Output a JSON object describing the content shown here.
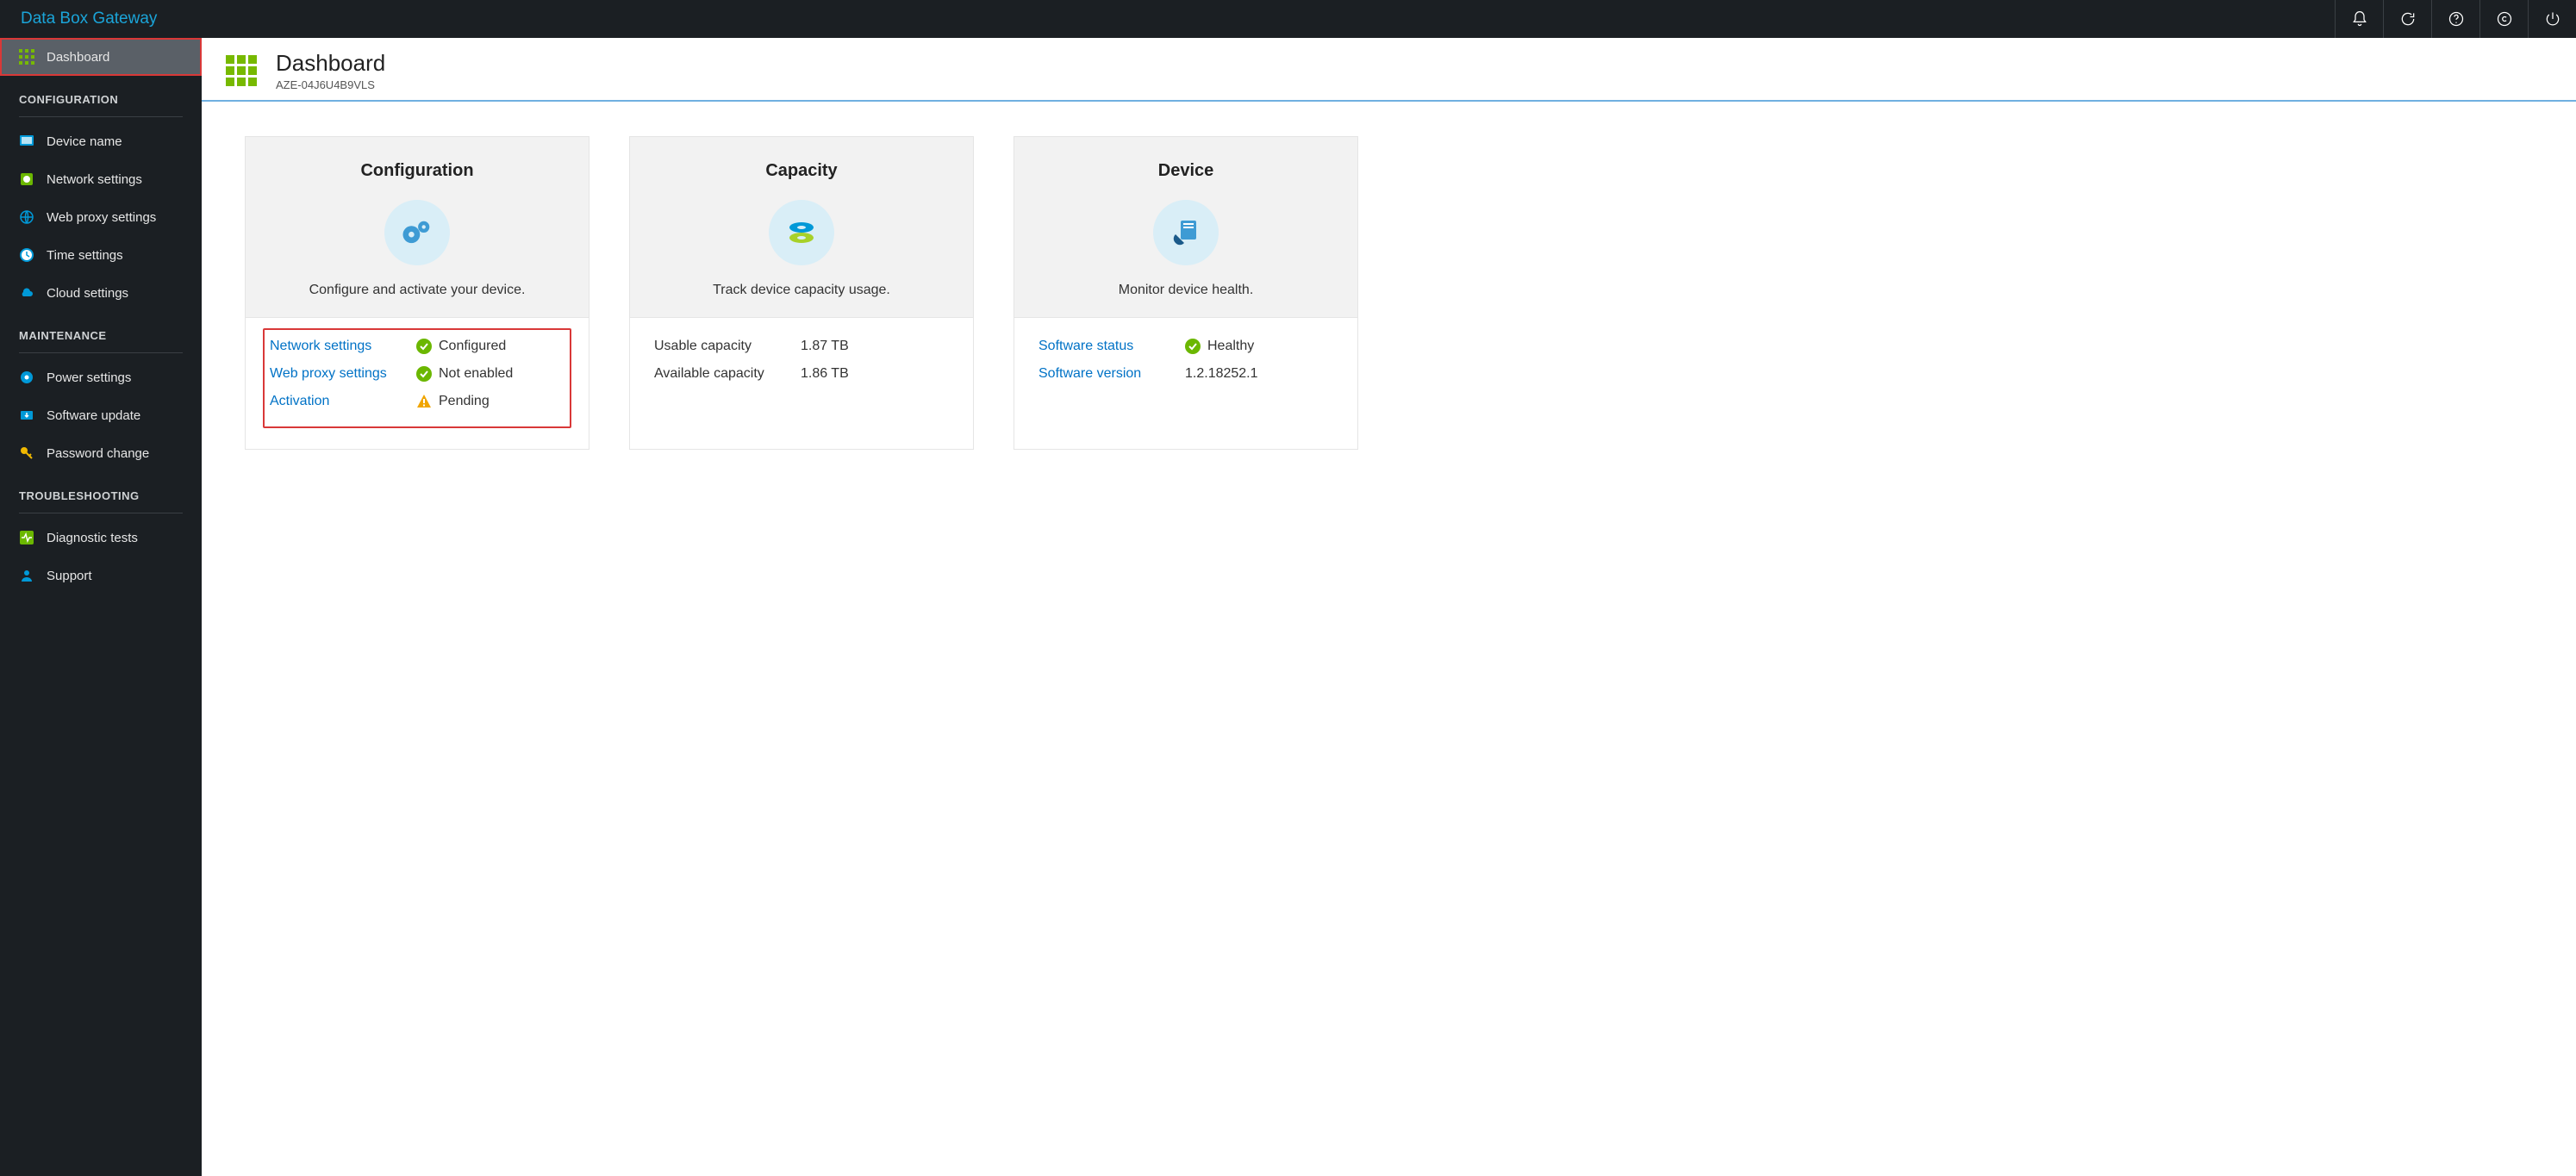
{
  "brand": "Data Box Gateway",
  "sidebar": {
    "dashboard": "Dashboard",
    "section_config": "CONFIGURATION",
    "device_name": "Device name",
    "network_settings": "Network settings",
    "web_proxy": "Web proxy settings",
    "time_settings": "Time settings",
    "cloud_settings": "Cloud settings",
    "section_maint": "MAINTENANCE",
    "power_settings": "Power settings",
    "software_update": "Software update",
    "password_change": "Password change",
    "section_trouble": "TROUBLESHOOTING",
    "diagnostic_tests": "Diagnostic tests",
    "support": "Support"
  },
  "header": {
    "title": "Dashboard",
    "subtitle": "AZE-04J6U4B9VLS"
  },
  "cards": {
    "config": {
      "title": "Configuration",
      "desc": "Configure and activate your device.",
      "rows": [
        {
          "label": "Network settings",
          "status": "ok",
          "value": "Configured"
        },
        {
          "label": "Web proxy settings",
          "status": "ok",
          "value": "Not enabled"
        },
        {
          "label": "Activation",
          "status": "warn",
          "value": "Pending"
        }
      ]
    },
    "capacity": {
      "title": "Capacity",
      "desc": "Track device capacity usage.",
      "rows": [
        {
          "label": "Usable capacity",
          "value": "1.87 TB"
        },
        {
          "label": "Available capacity",
          "value": "1.86 TB"
        }
      ]
    },
    "device": {
      "title": "Device",
      "desc": "Monitor device health.",
      "rows": [
        {
          "label": "Software status",
          "link": true,
          "status": "ok",
          "value": "Healthy"
        },
        {
          "label": "Software version",
          "link": true,
          "value": "1.2.18252.1"
        }
      ]
    }
  }
}
